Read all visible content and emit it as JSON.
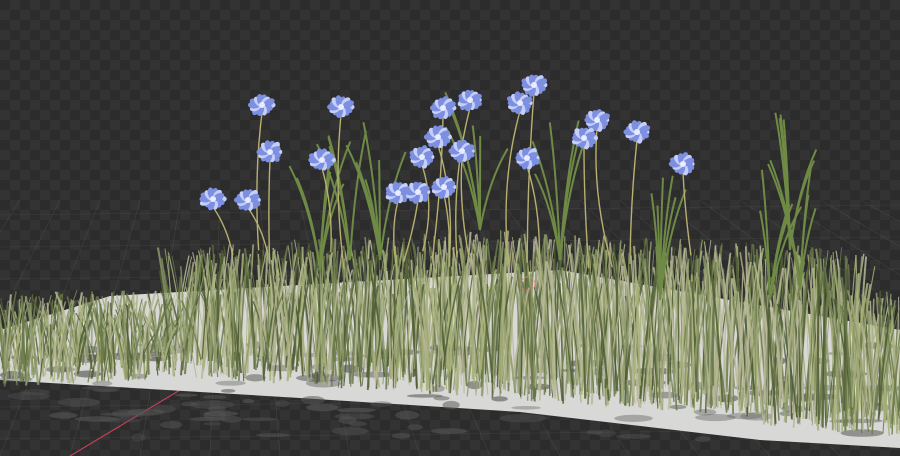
{
  "viewport": {
    "background": "transparent-checker",
    "grid_color": "#7a7a7a",
    "x_axis_color": "#c0405a",
    "ground_color": "#d8d8d6",
    "grass_colors": [
      "#6b7a4a",
      "#8e9a6a",
      "#b9b99a",
      "#4f5d35",
      "#a8b07a"
    ],
    "flower_color": "#7d8fe0",
    "flower_highlight": "#c6cffa",
    "stem_color": "#b8b070",
    "origin_marker": "3d-cursor",
    "scene_object": "grass-and-flower-patch"
  }
}
